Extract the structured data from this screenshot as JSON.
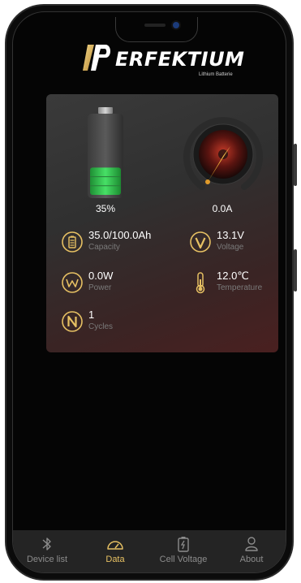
{
  "brand": {
    "logo_mark": "P",
    "name": "ERFEKTIUM",
    "subtitle": "Lithium Batterie"
  },
  "battery": {
    "percent_label": "35%",
    "level": 0.35,
    "fill_color": "#3ecf5a"
  },
  "current": {
    "value_label": "0.0A"
  },
  "metrics": {
    "capacity": {
      "value": "35.0/100.0Ah",
      "label": "Capacity",
      "icon": "battery-level-icon"
    },
    "voltage": {
      "value": "13.1V",
      "label": "Voltage",
      "icon": "voltage-icon",
      "glyph": "V"
    },
    "power": {
      "value": "0.0W",
      "label": "Power",
      "icon": "power-icon",
      "glyph": "W"
    },
    "temperature": {
      "value": "12.0℃",
      "label": "Temperature",
      "icon": "thermometer-icon"
    },
    "cycles": {
      "value": "1",
      "label": "Cycles",
      "icon": "cycles-icon",
      "glyph": "N"
    }
  },
  "nav": {
    "items": [
      {
        "label": "Device list",
        "icon": "bluetooth-icon",
        "active": false
      },
      {
        "label": "Data",
        "icon": "gauge-icon",
        "active": true
      },
      {
        "label": "Cell Voltage",
        "icon": "battery-cell-icon",
        "active": false
      },
      {
        "label": "About",
        "icon": "user-icon",
        "active": false
      }
    ]
  },
  "colors": {
    "accent": "#e6c063",
    "background": "#050505",
    "card": "#333333"
  }
}
